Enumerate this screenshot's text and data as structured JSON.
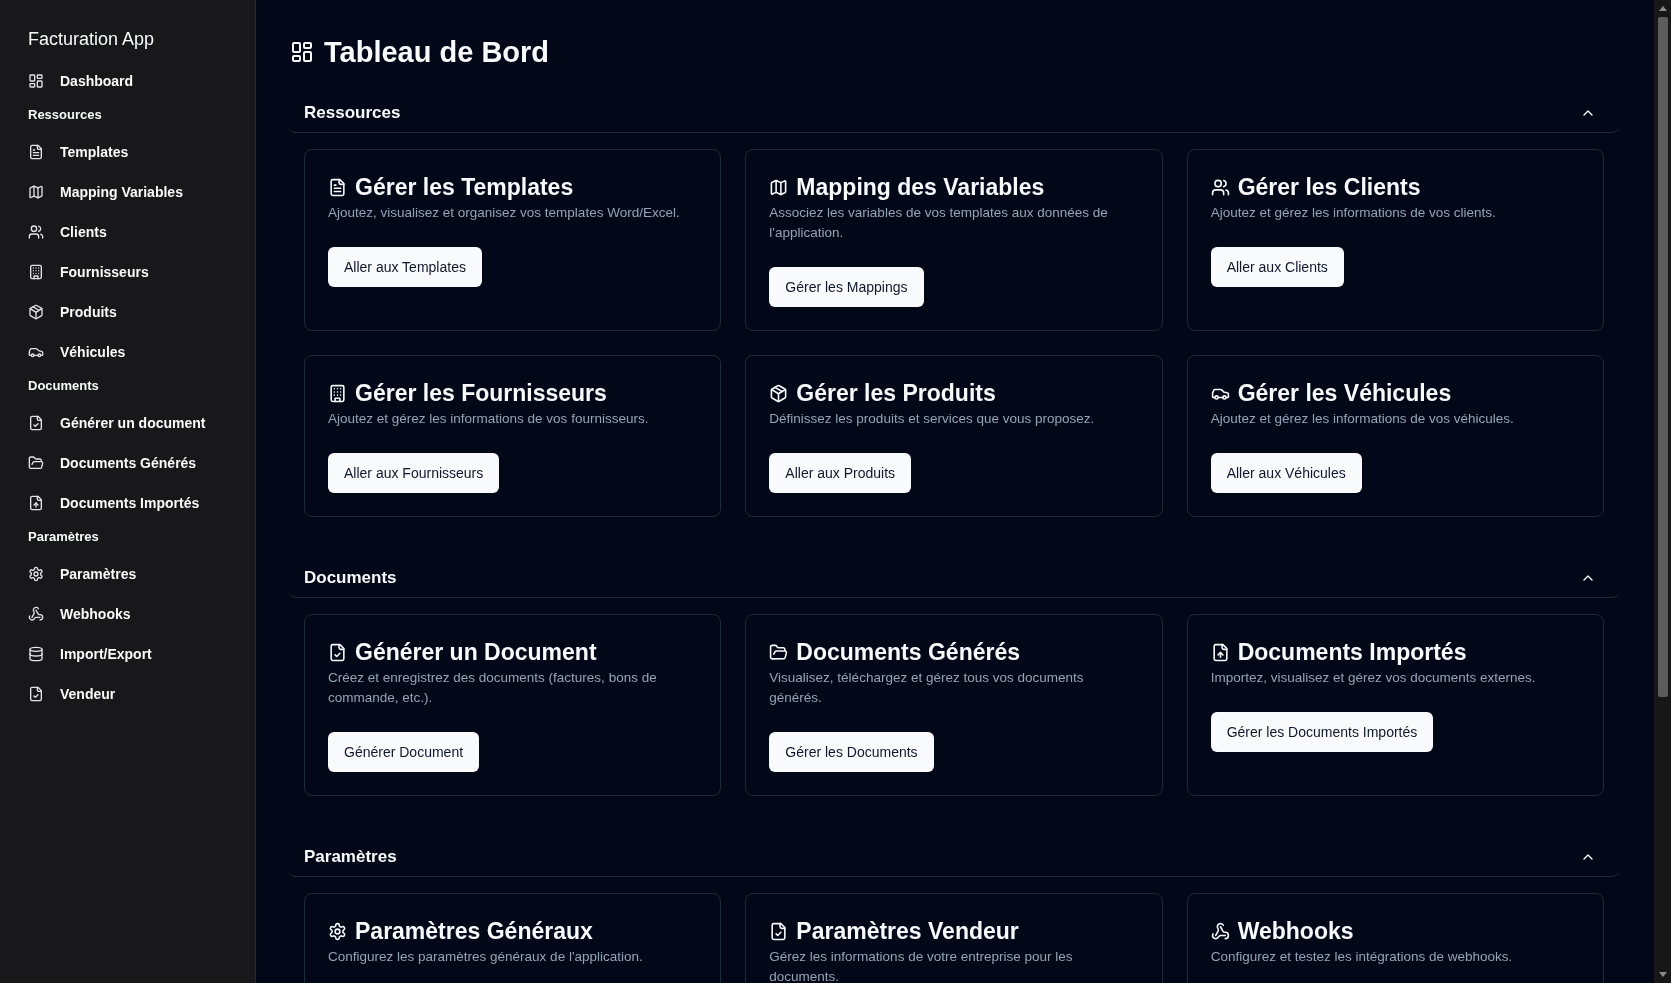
{
  "sidebar": {
    "title": "Facturation App",
    "items": [
      {
        "label": "Dashboard"
      }
    ],
    "groups": [
      {
        "label": "Ressources",
        "items": [
          {
            "label": "Templates"
          },
          {
            "label": "Mapping Variables"
          },
          {
            "label": "Clients"
          },
          {
            "label": "Fournisseurs"
          },
          {
            "label": "Produits"
          },
          {
            "label": "Véhicules"
          }
        ]
      },
      {
        "label": "Documents",
        "items": [
          {
            "label": "Générer un document"
          },
          {
            "label": "Documents Générés"
          },
          {
            "label": "Documents Importés"
          }
        ]
      },
      {
        "label": "Paramètres",
        "items": [
          {
            "label": "Paramètres"
          },
          {
            "label": "Webhooks"
          },
          {
            "label": "Import/Export"
          },
          {
            "label": "Vendeur"
          }
        ]
      }
    ]
  },
  "page": {
    "title": "Tableau de Bord"
  },
  "sections": [
    {
      "title": "Ressources",
      "expanded": true,
      "cards": [
        {
          "title": "Gérer les Templates",
          "description": "Ajoutez, visualisez et organisez vos templates Word/Excel.",
          "button": "Aller aux Templates"
        },
        {
          "title": "Mapping des Variables",
          "description": "Associez les variables de vos templates aux données de l'application.",
          "button": "Gérer les Mappings"
        },
        {
          "title": "Gérer les Clients",
          "description": "Ajoutez et gérez les informations de vos clients.",
          "button": "Aller aux Clients"
        },
        {
          "title": "Gérer les Fournisseurs",
          "description": "Ajoutez et gérez les informations de vos fournisseurs.",
          "button": "Aller aux Fournisseurs"
        },
        {
          "title": "Gérer les Produits",
          "description": "Définissez les produits et services que vous proposez.",
          "button": "Aller aux Produits"
        },
        {
          "title": "Gérer les Véhicules",
          "description": "Ajoutez et gérez les informations de vos véhicules.",
          "button": "Aller aux Véhicules"
        }
      ]
    },
    {
      "title": "Documents",
      "expanded": true,
      "cards": [
        {
          "title": "Générer un Document",
          "description": "Créez et enregistrez des documents (factures, bons de commande, etc.).",
          "button": "Générer Document"
        },
        {
          "title": "Documents Générés",
          "description": "Visualisez, téléchargez et gérez tous vos documents générés.",
          "button": "Gérer les Documents"
        },
        {
          "title": "Documents Importés",
          "description": "Importez, visualisez et gérez vos documents externes.",
          "button": "Gérer les Documents Importés"
        }
      ]
    },
    {
      "title": "Paramètres",
      "expanded": true,
      "cards": [
        {
          "title": "Paramètres Généraux",
          "description": "Configurez les paramètres généraux de l'application."
        },
        {
          "title": "Paramètres Vendeur",
          "description": "Gérez les informations de votre entreprise pour les documents."
        },
        {
          "title": "Webhooks",
          "description": "Configurez et testez les intégrations de webhooks."
        }
      ]
    }
  ]
}
